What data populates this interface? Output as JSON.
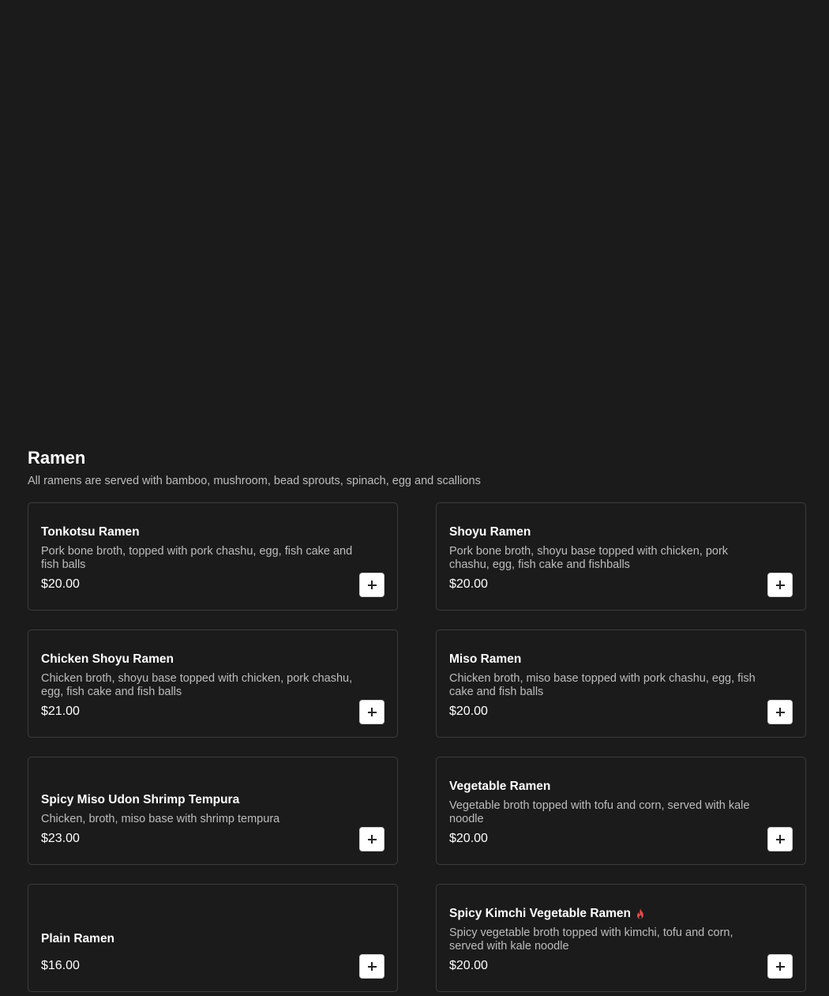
{
  "section": {
    "title": "Ramen",
    "subtitle": "All ramens are served with bamboo, mushroom, bead sprouts, spinach, egg and scallions"
  },
  "items": [
    {
      "name": "Tonkotsu Ramen",
      "description": "Pork bone broth, topped with pork chashu, egg, fish cake and fish balls",
      "price": "$20.00",
      "spicy": false
    },
    {
      "name": "Shoyu Ramen",
      "description": "Pork bone broth, shoyu base topped with chicken, pork chashu, egg, fish cake and fishballs",
      "price": "$20.00",
      "spicy": false
    },
    {
      "name": "Chicken Shoyu Ramen",
      "description": "Chicken broth, shoyu base topped with chicken, pork chashu, egg, fish cake and fish balls",
      "price": "$21.00",
      "spicy": false
    },
    {
      "name": "Miso Ramen",
      "description": "Chicken broth, miso base topped with pork chashu, egg, fish cake and fish balls",
      "price": "$20.00",
      "spicy": false
    },
    {
      "name": "Spicy Miso Udon Shrimp Tempura",
      "description": "Chicken, broth, miso base with shrimp tempura",
      "price": "$23.00",
      "spicy": false
    },
    {
      "name": "Vegetable Ramen",
      "description": "Vegetable broth topped with tofu and corn, served with kale noodle",
      "price": "$20.00",
      "spicy": false
    },
    {
      "name": "Plain Ramen",
      "description": "",
      "price": "$16.00",
      "spicy": false
    },
    {
      "name": "Spicy Kimchi Vegetable Ramen",
      "description": "Spicy vegetable broth topped with kimchi, tofu and corn, served with kale noodle",
      "price": "$20.00",
      "spicy": true
    }
  ],
  "icons": {
    "add": "plus-icon",
    "spicy": "flame-icon"
  },
  "colors": {
    "background": "#1b1b1b",
    "card_border": "#3c3c3c",
    "text_primary": "#ffffff",
    "text_secondary": "#bdbdbd",
    "button_bg": "#ffffff",
    "spicy": "#e24b4b"
  }
}
